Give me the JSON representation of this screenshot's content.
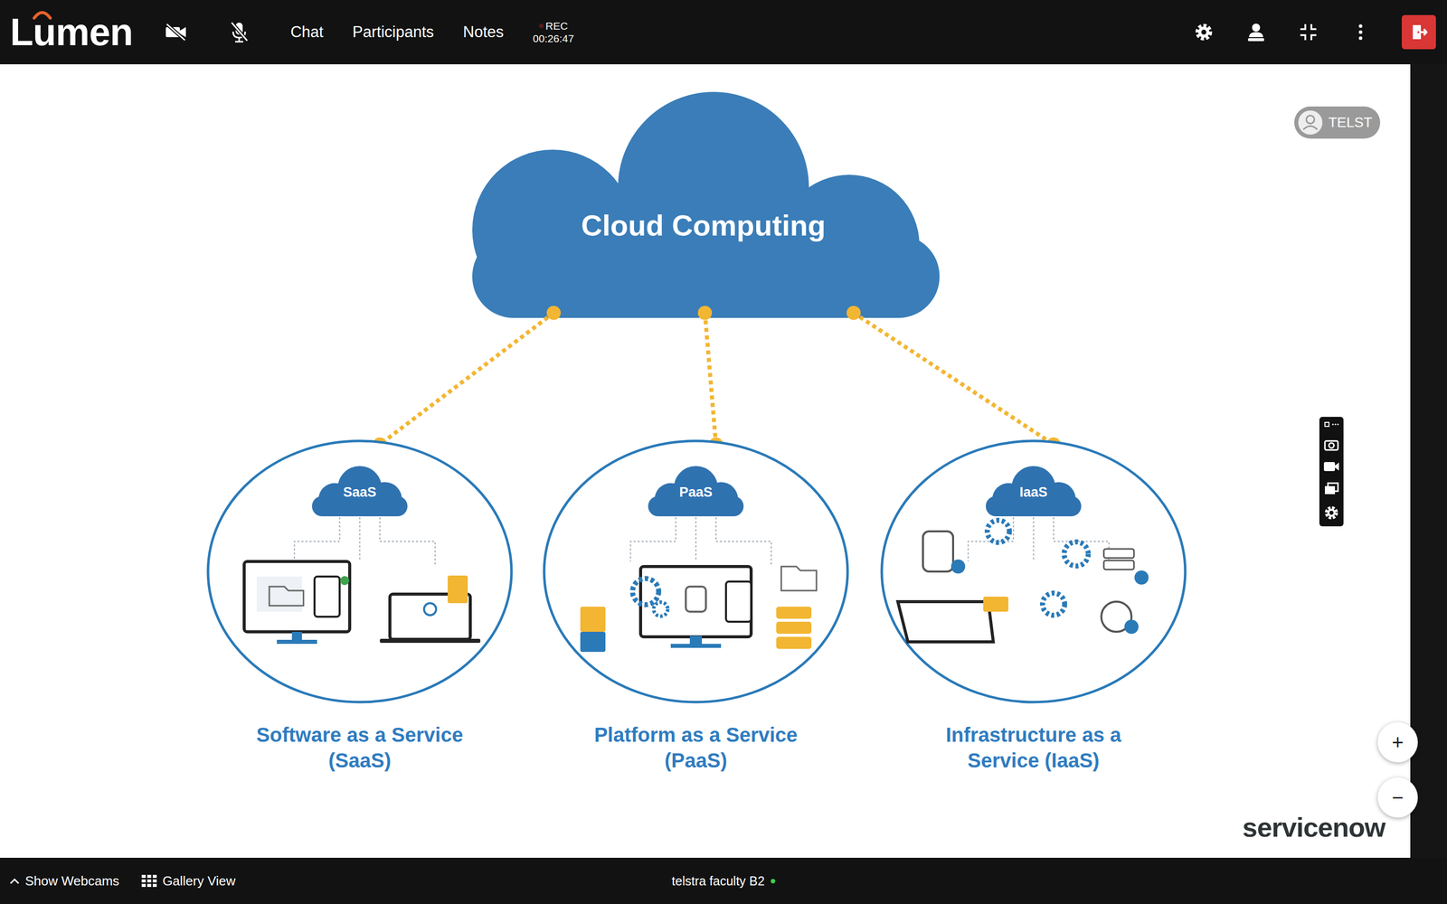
{
  "toolbar": {
    "logo": "Lumen",
    "camera_on": false,
    "mic_on": false,
    "menu": [
      "Chat",
      "Participants",
      "Notes"
    ],
    "recording": {
      "label": "REC",
      "time": "00:26:47"
    }
  },
  "presenter_badge": "TELST",
  "slide": {
    "title": "Cloud Computing",
    "services": [
      {
        "kind": "software",
        "badge": "SaaS",
        "lines": [
          "Software as a Service",
          "(SaaS)"
        ]
      },
      {
        "kind": "platform",
        "badge": "PaaS",
        "lines": [
          "Platform as a Service",
          "(PaaS)"
        ]
      },
      {
        "kind": "infrastructure",
        "badge": "IaaS",
        "lines": [
          "Infrastructure as a",
          "Service (IaaS)"
        ]
      }
    ],
    "brand": "servicenow"
  },
  "zoom": [
    "+",
    "−"
  ],
  "bottom_bar": {
    "webcams_toggle": "Show Webcams",
    "gallery": "Gallery View",
    "room": "telstra faculty B2",
    "room_online": true
  }
}
